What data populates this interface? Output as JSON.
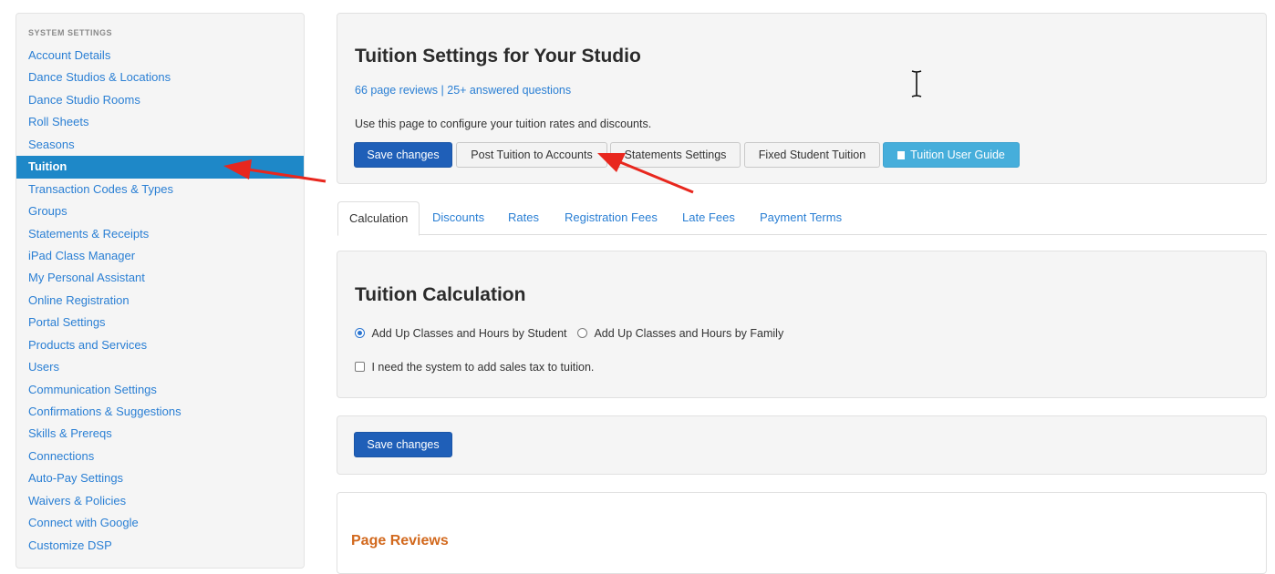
{
  "sidebar": {
    "header": "SYSTEM SETTINGS",
    "items": [
      {
        "label": "Account Details"
      },
      {
        "label": "Dance Studios & Locations"
      },
      {
        "label": "Dance Studio Rooms"
      },
      {
        "label": "Roll Sheets"
      },
      {
        "label": "Seasons"
      },
      {
        "label": "Tuition"
      },
      {
        "label": "Transaction Codes & Types"
      },
      {
        "label": "Groups"
      },
      {
        "label": "Statements & Receipts"
      },
      {
        "label": "iPad Class Manager"
      },
      {
        "label": "My Personal Assistant"
      },
      {
        "label": "Online Registration"
      },
      {
        "label": "Portal Settings"
      },
      {
        "label": "Products and Services"
      },
      {
        "label": "Users"
      },
      {
        "label": "Communication Settings"
      },
      {
        "label": "Confirmations & Suggestions"
      },
      {
        "label": "Skills & Prereqs"
      },
      {
        "label": "Connections"
      },
      {
        "label": "Auto-Pay Settings"
      },
      {
        "label": "Waivers & Policies"
      },
      {
        "label": "Connect with Google"
      },
      {
        "label": "Customize DSP"
      }
    ],
    "active_label": "Tuition"
  },
  "header": {
    "title": "Tuition Settings for Your Studio",
    "reviews_link": "66 page reviews",
    "separator": "|",
    "questions_link": "25+ answered questions",
    "description": "Use this page to configure your tuition rates and discounts.",
    "buttons": {
      "save": "Save changes",
      "post_tuition": "Post Tuition to Accounts",
      "statements": "Statements Settings",
      "fixed": "Fixed Student Tuition",
      "guide": "Tuition User Guide"
    }
  },
  "tabs": {
    "calculation": "Calculation",
    "discounts": "Discounts",
    "rates": "Rates",
    "registration_fees": "Registration Fees",
    "late_fees": "Late Fees",
    "payment_terms": "Payment Terms"
  },
  "calculation": {
    "title": "Tuition Calculation",
    "option_student": "Add Up Classes and Hours by Student",
    "option_family": "Add Up Classes and Hours by Family",
    "sales_tax": "I need the system to add sales tax to tuition."
  },
  "footer_save": "Save changes",
  "reviews_section": {
    "title": "Page Reviews"
  },
  "colors": {
    "link": "#2a7fd4",
    "active_sidebar": "#1e88c8",
    "primary_button": "#1f5fb8",
    "info_button": "#46aedb",
    "annotation_arrow": "#e8271e",
    "reviews_title": "#d2691e"
  }
}
